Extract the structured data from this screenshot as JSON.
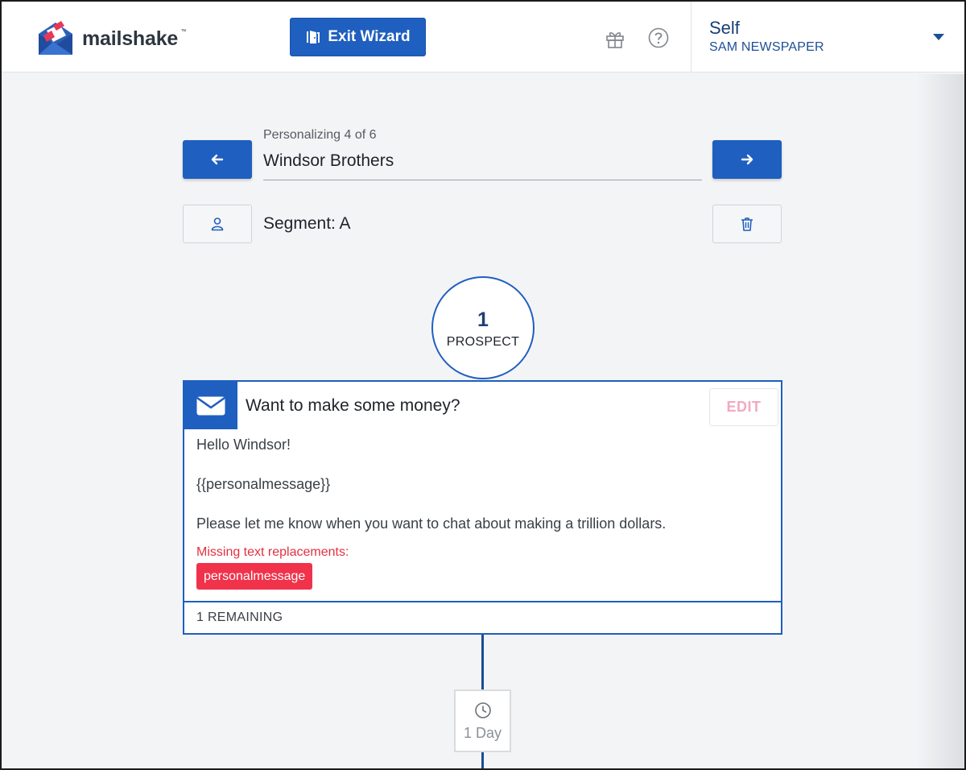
{
  "brand": {
    "name": "mailshake",
    "tm": "™"
  },
  "header": {
    "exit_label": "Exit Wizard",
    "account_name": "Self",
    "account_org": "SAM NEWSPAPER",
    "icons": [
      "gift-icon",
      "help-icon",
      "chevron-down-icon"
    ]
  },
  "personalize": {
    "progress": "Personalizing 4 of 6",
    "prospect_name": "Windsor Brothers",
    "segment": "Segment: A"
  },
  "step": {
    "count": "1",
    "label": "PROSPECT"
  },
  "email": {
    "subject": "Want to make some money?",
    "edit_label": "EDIT",
    "body_lines": [
      "Hello Windsor!",
      "{{personalmessage}}",
      "Please let me know when you want to chat about making a trillion dollars."
    ],
    "missing_label": "Missing text replacements:",
    "missing_tags": [
      "personalmessage"
    ],
    "remaining": "1 REMAINING"
  },
  "delay": {
    "label": "1 Day"
  },
  "colors": {
    "primary": "#1f5fbf",
    "navy_text": "#173f78",
    "error": "#f0324a",
    "edit_disabled": "#f2a9c2",
    "background": "#f3f4f6"
  }
}
